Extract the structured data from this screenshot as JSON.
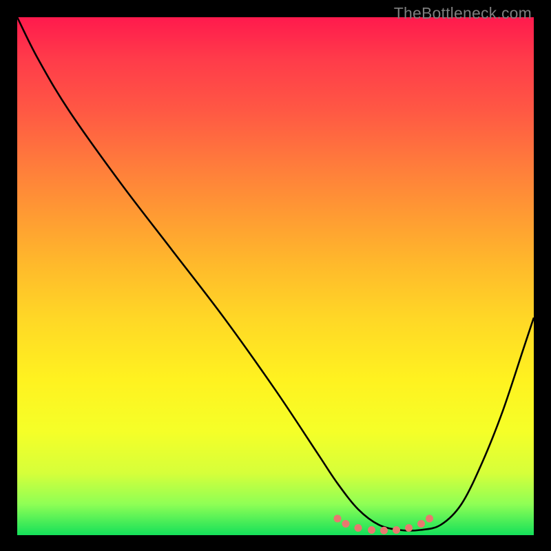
{
  "watermark": "TheBottleneck.com",
  "colors": {
    "frame": "#000000",
    "top_gradient": "#ff1a4d",
    "bottom_gradient": "#14e05a",
    "curve": "#000000",
    "marker": "#e9786f"
  },
  "chart_data": {
    "type": "line",
    "title": "",
    "xlabel": "",
    "ylabel": "",
    "xlim": [
      0,
      100
    ],
    "ylim": [
      0,
      100
    ],
    "series": [
      {
        "name": "bottleneck-curve",
        "x": [
          0,
          4,
          10,
          20,
          30,
          40,
          50,
          58,
          62,
          66,
          70,
          74,
          78,
          82,
          86,
          90,
          94,
          98,
          100
        ],
        "y": [
          100,
          92,
          82,
          68,
          55,
          42,
          28,
          16,
          10,
          5,
          2,
          1,
          1,
          2,
          6,
          14,
          24,
          36,
          42
        ]
      }
    ],
    "markers": {
      "name": "highlight-dots",
      "color": "#e9786f",
      "points": [
        {
          "x": 62,
          "y": 3.2
        },
        {
          "x": 63.6,
          "y": 2.2
        },
        {
          "x": 66,
          "y": 1.4
        },
        {
          "x": 68.6,
          "y": 1.0
        },
        {
          "x": 71,
          "y": 0.9
        },
        {
          "x": 73.4,
          "y": 1.0
        },
        {
          "x": 75.8,
          "y": 1.4
        },
        {
          "x": 78.2,
          "y": 2.2
        },
        {
          "x": 79.8,
          "y": 3.2
        }
      ]
    },
    "notes": "No axes, ticks, or numeric labels are visible; curve y-height read as percentage of plot area, valley at ~x=72."
  }
}
